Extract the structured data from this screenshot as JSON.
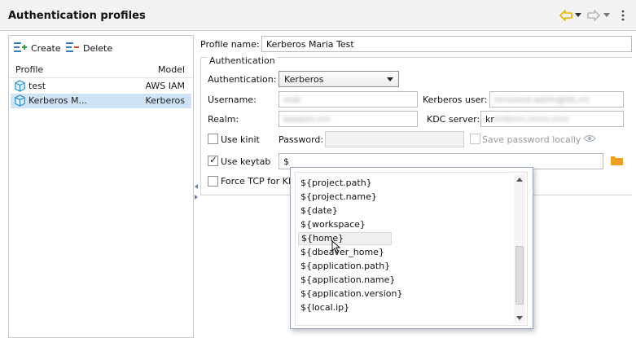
{
  "header": {
    "title": "Authentication profiles",
    "icons": [
      "back-arrow-icon",
      "dropdown-caret-icon",
      "forward-arrow-icon",
      "more-options-icon"
    ],
    "accent_color": "#e8b400"
  },
  "toolbar": {
    "create_label": "Create",
    "delete_label": "Delete"
  },
  "profiles_table": {
    "columns": [
      "Profile",
      "Model"
    ],
    "rows": [
      {
        "name": "test",
        "model": "AWS IAM",
        "selected": false
      },
      {
        "name": "Kerberos M...",
        "model": "Kerberos",
        "selected": true
      }
    ]
  },
  "form": {
    "profile_name_label": "Profile name:",
    "profile_name_value": "Kerberos Maria Test",
    "group_title": "Authentication",
    "authentication_label": "Authentication:",
    "authentication_value": "Kerberos",
    "username_label": "Username:",
    "username_value": "mdi",
    "kerberos_user_label": "Kerberos user:",
    "kerberos_user_value": "mrsomit.kkhh@ttt.rrt",
    "realm_label": "Realm:",
    "realm_value": "kkkktrr.rrrr",
    "kdc_server_label": "KDC server:",
    "kdc_server_value": "kr",
    "kdc_server_hidden": "rrrttrrrr.rrrrrr.rrrrr",
    "use_kinit_label": "Use kinit",
    "use_kinit_checked": false,
    "password_label": "Password:",
    "password_value": "",
    "save_password_label": "Save password locally",
    "use_keytab_label": "Use keytab",
    "use_keytab_checked": true,
    "keytab_value": "$",
    "force_tcp_label": "Force TCP for KD",
    "force_tcp_checked": false
  },
  "autocomplete": {
    "items": [
      "${project.path}",
      "${project.name}",
      "${date}",
      "${workspace}",
      "${home}",
      "${dbeaver_home}",
      "${application.path}",
      "${application.name}",
      "${application.version}",
      "${local.ip}"
    ],
    "hover_index": 4
  },
  "colors": {
    "selection": "#cfe3f6",
    "folder": "#f0a020",
    "profile_icon": "#2b8fd6",
    "create_icon": "#2f9c4a",
    "delete_icon": "#d04a2a"
  }
}
